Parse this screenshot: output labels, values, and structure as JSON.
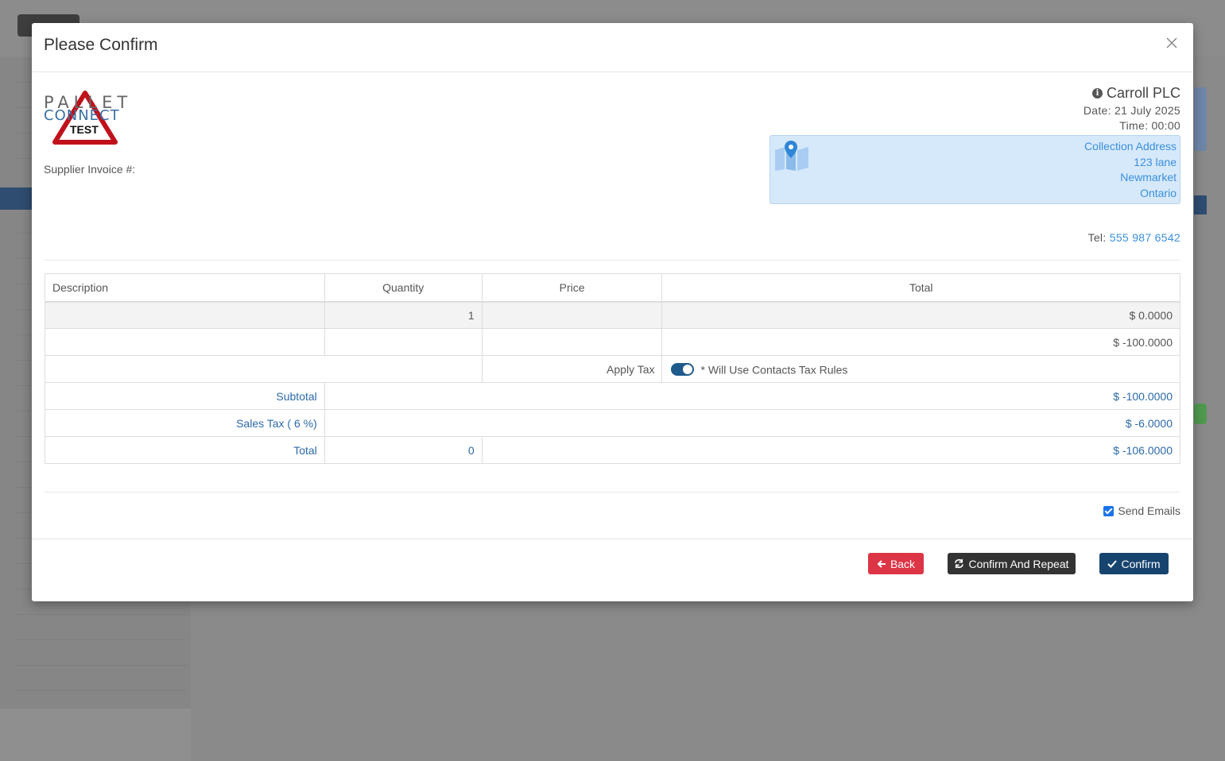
{
  "modal": {
    "title": "Please Confirm",
    "close_icon": "close-icon"
  },
  "logo": {
    "line1": "PALLET",
    "line2": "CONNECT",
    "badge": "TEST"
  },
  "supplier_invoice_label": "Supplier Invoice #:",
  "company": {
    "name": "Carroll PLC",
    "date": "Date: 21 July 2025",
    "time": "Time: 00:00"
  },
  "address": {
    "heading": "Collection Address",
    "line1": "123 lane",
    "line2": "Newmarket",
    "line3": "Ontario"
  },
  "tel": {
    "label": "Tel:",
    "number": "555 987 6542"
  },
  "table": {
    "headers": [
      "Description",
      "Quantity",
      "Price",
      "Total"
    ],
    "rows": [
      {
        "description": "",
        "quantity": "1",
        "price": "",
        "total": "$ 0.0000"
      },
      {
        "description": "",
        "quantity": "",
        "price": "",
        "total": "$ -100.0000"
      }
    ],
    "apply_tax_label": "Apply Tax",
    "tax_note": "* Will Use Contacts Tax Rules",
    "subtotal_label": "Subtotal",
    "subtotal_value": "$ -100.0000",
    "sales_tax_label": "Sales Tax ( 6 %)",
    "sales_tax_value": "$ -6.0000",
    "total_label": "Total",
    "total_quantity": "0",
    "total_value": "$ -106.0000"
  },
  "send_emails_label": "Send Emails",
  "footer": {
    "back_label": "Back",
    "confirm_repeat_label": "Confirm And Repeat",
    "confirm_label": "Confirm"
  },
  "colors": {
    "accent_blue": "#3b8fdd",
    "dark_blue": "#17446e",
    "danger": "#dc3545",
    "dark": "#333333"
  }
}
